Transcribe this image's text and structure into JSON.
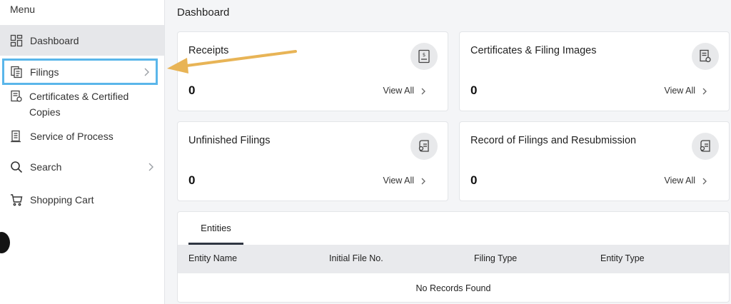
{
  "sidebar": {
    "menu_title": "Menu",
    "items": [
      {
        "label": "Dashboard",
        "icon": "dashboard-grid-icon"
      },
      {
        "label": "Filings",
        "icon": "filings-docs-icon"
      },
      {
        "label": "Certificates & Certified\nCopies",
        "icon": "certificate-icon"
      },
      {
        "label": "Service of Process",
        "icon": "service-process-icon"
      },
      {
        "label": "Search",
        "icon": "search-icon"
      },
      {
        "label": "Shopping Cart",
        "icon": "cart-icon"
      }
    ]
  },
  "header": {
    "title": "Dashboard"
  },
  "cards": [
    {
      "title": "Receipts",
      "count": "0",
      "link": "View All",
      "icon": "receipt-dollar-icon"
    },
    {
      "title": "Certificates & Filing Images",
      "count": "0",
      "link": "View All",
      "icon": "certificate-doc-icon"
    },
    {
      "title": "Unfinished Filings",
      "count": "0",
      "link": "View All",
      "icon": "filing-list-icon"
    },
    {
      "title": "Record of Filings and Resubmission",
      "count": "0",
      "link": "View All",
      "icon": "filing-list-icon"
    }
  ],
  "entities": {
    "tab_label": "Entities",
    "columns": [
      "Entity Name",
      "Initial File No.",
      "Filing Type",
      "Entity Type"
    ],
    "empty_text": "No Records Found"
  },
  "colors": {
    "highlight_border": "#5ab6ea",
    "annotation_arrow": "#e8b456",
    "active_item_bg": "#e6e7ea"
  }
}
